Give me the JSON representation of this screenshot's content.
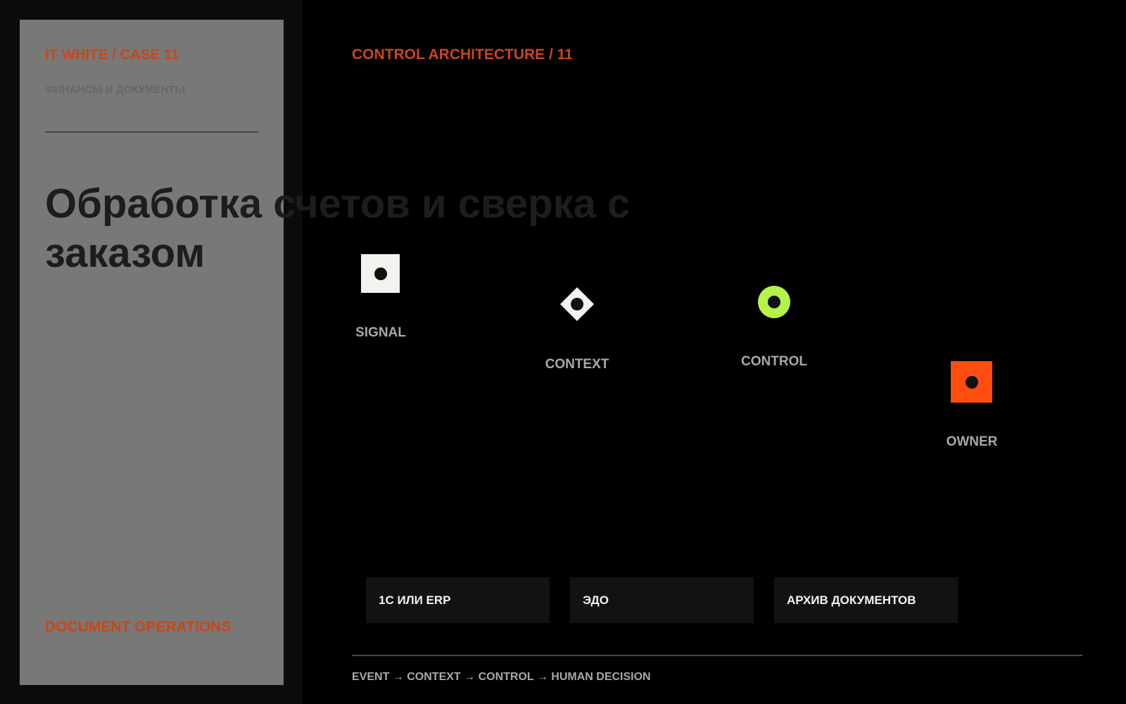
{
  "left_panel": {
    "case_tag": "IT WHITE / CASE 11",
    "category": "ФИНАНСЫ И ДОКУМЕНТЫ",
    "title": "Обработка счетов и сверка с заказом",
    "ops_label": "DOCUMENT OPERATIONS"
  },
  "architecture": {
    "title": "CONTROL ARCHITECTURE / 11",
    "nodes": [
      {
        "label": "SIGNAL",
        "icon": "square-dot-icon",
        "color": "#f2f2ef"
      },
      {
        "label": "CONTEXT",
        "icon": "diamond-dot-icon",
        "color": "#f2f2ef"
      },
      {
        "label": "CONTROL",
        "icon": "ring-icon",
        "color": "#b5f24a"
      },
      {
        "label": "OWNER",
        "icon": "square-dot-icon",
        "color": "#ff4d0f"
      }
    ],
    "systems": [
      {
        "label": "1С ИЛИ ERP"
      },
      {
        "label": "ЭДО"
      },
      {
        "label": "АРХИВ ДОКУМЕНТОВ"
      }
    ],
    "flow": "EVENT → CONTEXT → CONTROL → HUMAN DECISION"
  },
  "colors": {
    "accent": "#c8471c",
    "panel": "#787876",
    "background": "#000000",
    "card": "#111214"
  }
}
